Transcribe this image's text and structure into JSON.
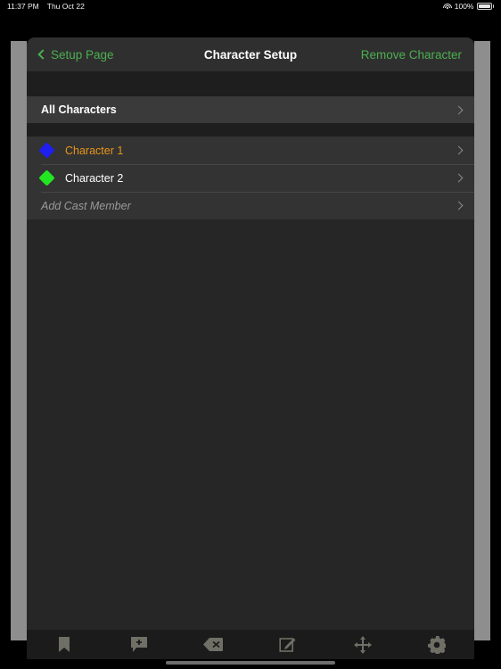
{
  "status_bar": {
    "time": "11:37 PM",
    "date": "Thu Oct 22",
    "wifi_icon": "wifi-icon",
    "battery_percent": "100%",
    "battery_icon": "battery-full-icon"
  },
  "nav": {
    "back_icon": "chevron-left-icon",
    "back_label": "Setup Page",
    "title": "Character Setup",
    "action_label": "Remove Character",
    "accent_color": "#4caf50"
  },
  "sections": {
    "header_row": {
      "label": "All Characters",
      "disclosure_icon": "chevron-right-icon"
    },
    "cast": [
      {
        "label": "Character 1",
        "swatch_icon": "diamond-icon",
        "swatch_color": "#1f1fee",
        "label_color": "#e8941a",
        "disclosure_icon": "chevron-right-icon"
      },
      {
        "label": "Character 2",
        "swatch_icon": "diamond-icon",
        "swatch_color": "#22e622",
        "label_color": "#ffffff",
        "disclosure_icon": "chevron-right-icon"
      }
    ],
    "add_row": {
      "label": "Add Cast Member",
      "disclosure_icon": "chevron-right-icon"
    }
  },
  "toolbar": {
    "items": [
      {
        "icon": "bookmark-icon",
        "label": "Bookmark"
      },
      {
        "icon": "add-note-icon",
        "label": "Add Note"
      },
      {
        "icon": "delete-icon",
        "label": "Delete"
      },
      {
        "icon": "edit-icon",
        "label": "Edit"
      },
      {
        "icon": "move-icon",
        "label": "Move"
      },
      {
        "icon": "settings-gear-icon",
        "label": "Settings"
      }
    ]
  }
}
